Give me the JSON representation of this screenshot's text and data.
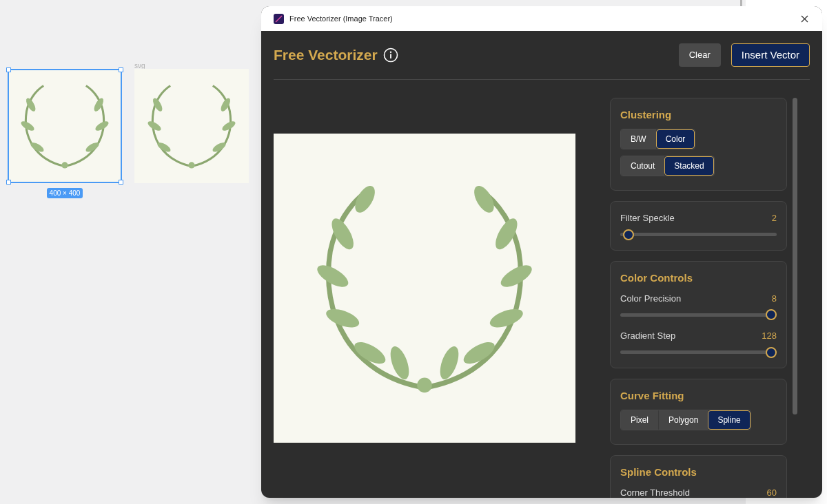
{
  "canvas": {
    "frames": [
      {
        "selected": true,
        "badge": "400 × 400"
      },
      {
        "selected": false,
        "label": "svg"
      }
    ]
  },
  "dialog": {
    "title": "Free Vectorizer (Image Tracer)",
    "header": {
      "title": "Free Vectorizer",
      "buttons": [
        {
          "label": "Clear",
          "kind": "secondary"
        },
        {
          "label": "Insert Vector",
          "kind": "primary"
        }
      ]
    },
    "panels": [
      {
        "kind": "segments",
        "title": "Clustering",
        "groups": [
          [
            {
              "label": "B/W",
              "selected": false
            },
            {
              "label": "Color",
              "selected": true
            }
          ],
          [
            {
              "label": "Cutout",
              "selected": false
            },
            {
              "label": "Stacked",
              "selected": true
            }
          ]
        ]
      },
      {
        "kind": "sliders",
        "sliders": [
          {
            "label": "Filter Speckle",
            "value": "2",
            "level": 0.02
          }
        ]
      },
      {
        "kind": "sliders",
        "title": "Color Controls",
        "sliders": [
          {
            "label": "Color Precision",
            "value": "8",
            "level": 1
          },
          {
            "label": "Gradient Step",
            "value": "128",
            "level": 1
          }
        ]
      },
      {
        "kind": "segments",
        "title": "Curve Fitting",
        "groups": [
          [
            {
              "label": "Pixel",
              "selected": false
            },
            {
              "label": "Polygon",
              "selected": false
            },
            {
              "label": "Spline",
              "selected": true
            }
          ]
        ]
      },
      {
        "kind": "sliders",
        "title": "Spline Controls",
        "sliders": [
          {
            "label": "Corner Threshold",
            "value": "60"
          }
        ]
      }
    ]
  }
}
